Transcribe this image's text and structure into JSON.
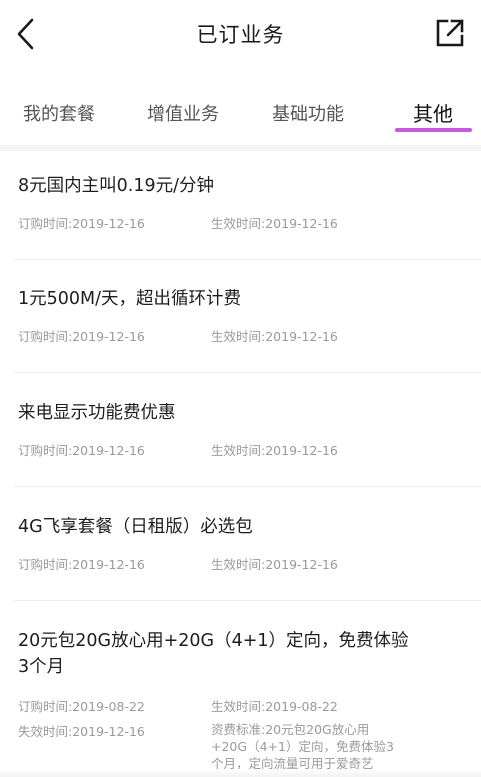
{
  "header": {
    "title": "已订业务"
  },
  "tabs": [
    {
      "label": "我的套餐",
      "active": false
    },
    {
      "label": "增值业务",
      "active": false
    },
    {
      "label": "基础功能",
      "active": false
    },
    {
      "label": "其他",
      "active": true
    }
  ],
  "colors": {
    "accent": "#c45bdc",
    "meta_text": "#9a9a9a"
  },
  "items": [
    {
      "name": "8元国内主叫0.19元/分钟",
      "order_time": "订购时间:2019-12-16",
      "effective_time": "生效时间:2019-12-16"
    },
    {
      "name": "1元500M/天，超出循环计费",
      "order_time": "订购时间:2019-12-16",
      "effective_time": "生效时间:2019-12-16"
    },
    {
      "name": "来电显示功能费优惠",
      "order_time": "订购时间:2019-12-16",
      "effective_time": "生效时间:2019-12-16"
    },
    {
      "name": "4G飞享套餐（日租版）必选包",
      "order_time": "订购时间:2019-12-16",
      "effective_time": "生效时间:2019-12-16"
    },
    {
      "name_line1": "20元包20G放心用+20G（4+1）定向，免费体验",
      "name_line2": "3个月",
      "order_time": "订购时间:2019-08-22",
      "effective_time": "生效时间:2019-08-22",
      "expire_time": "失效时间:2019-12-16",
      "fee_line1": "资费标准:20元包20G放心用",
      "fee_line2": "+20G（4+1）定向，免费体验3",
      "fee_line3": "个月，定向流量可用于爱奇艺"
    }
  ]
}
